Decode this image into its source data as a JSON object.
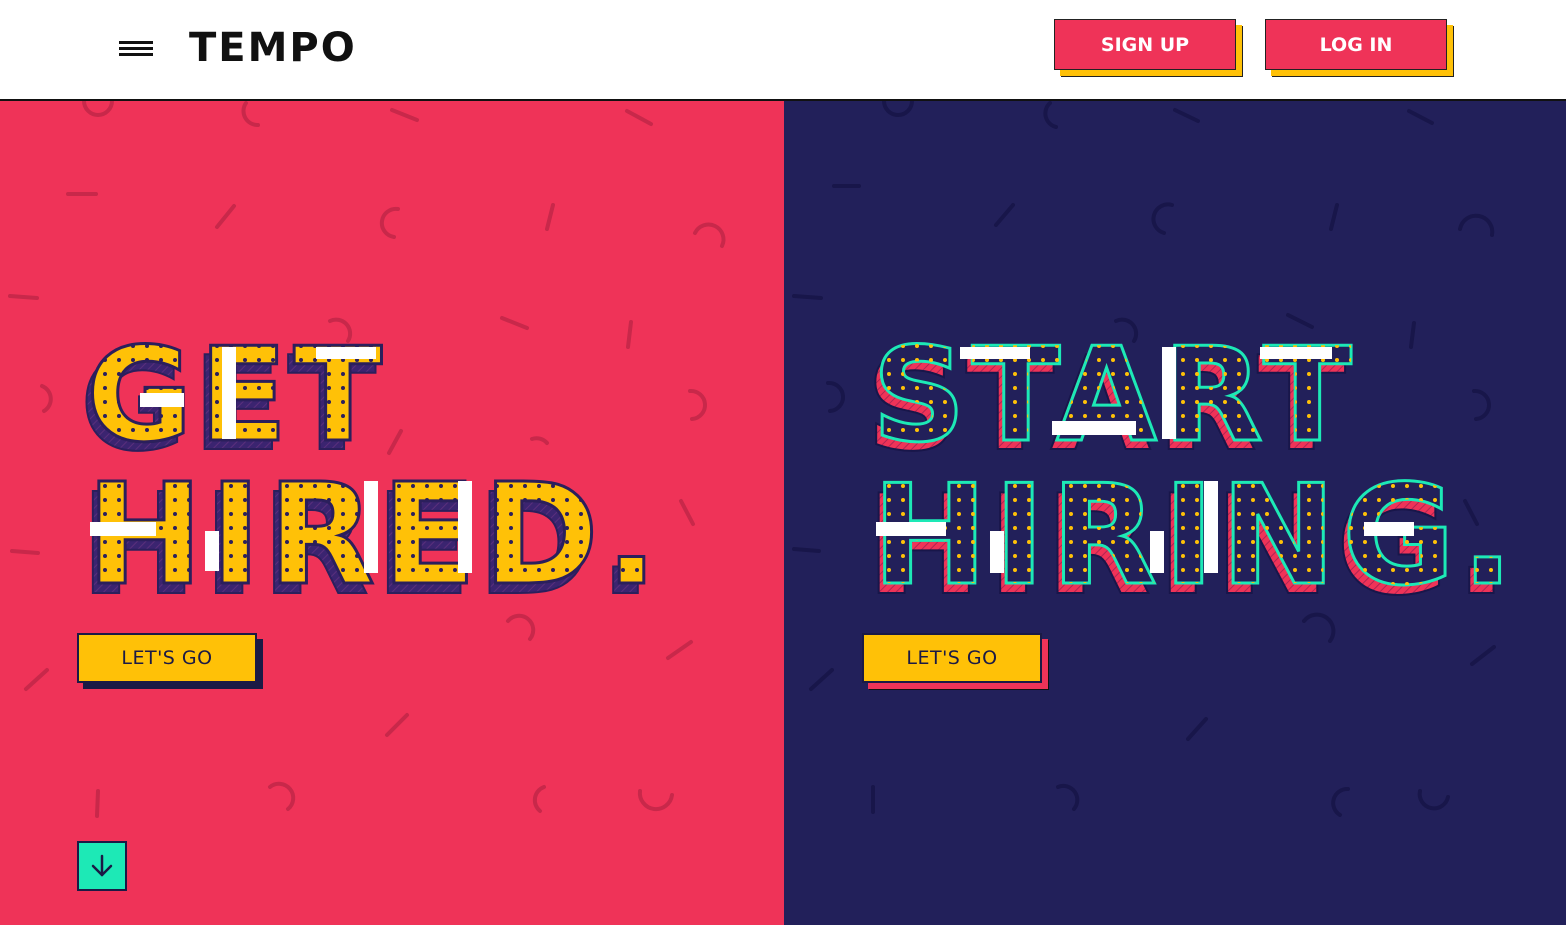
{
  "header": {
    "logo": "TEMPO",
    "sign_up_label": "SIGN UP",
    "log_in_label": "LOG IN"
  },
  "left_panel": {
    "headline_line1": "GET",
    "headline_line2": "HIRED.",
    "cta_label": "LET'S GO"
  },
  "right_panel": {
    "headline_line1": "START",
    "headline_line2": "HIRING.",
    "cta_label": "LET'S GO"
  },
  "icons": {
    "menu": "hamburger-menu-icon",
    "scroll": "arrow-down-icon"
  },
  "colors": {
    "pink": "#ef3358",
    "navy": "#22205a",
    "yellow": "#ffc107",
    "teal": "#1de9b6",
    "white": "#ffffff"
  }
}
